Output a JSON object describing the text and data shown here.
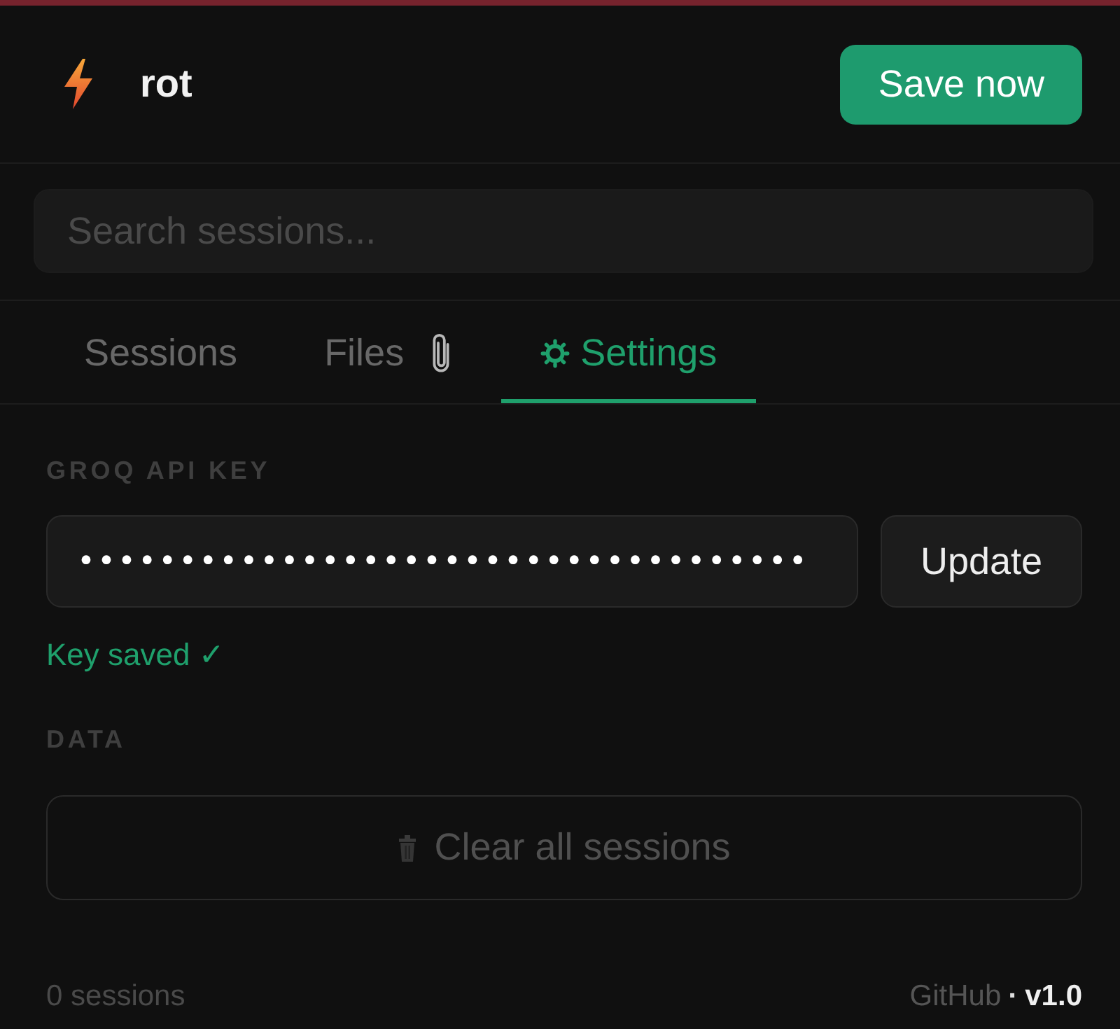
{
  "header": {
    "title": "rot",
    "save_button": "Save now"
  },
  "search": {
    "placeholder": "Search sessions..."
  },
  "tabs": [
    {
      "label": "Sessions",
      "selected": false,
      "kind": "plain"
    },
    {
      "label": "Files",
      "selected": false,
      "kind": "clip_after"
    },
    {
      "label": "Settings",
      "selected": true,
      "kind": "gear_before"
    }
  ],
  "api_key": {
    "label": "GROQ API KEY",
    "value": "••••••••••••••••••••••••••••••••••••",
    "button": "Update",
    "status": "Key saved ✓"
  },
  "data": {
    "label": "DATA",
    "clear_button": "Clear all sessions"
  },
  "footer": {
    "count": "0 sessions",
    "link": "GitHub",
    "separator": "·",
    "version": "v1.0"
  }
}
